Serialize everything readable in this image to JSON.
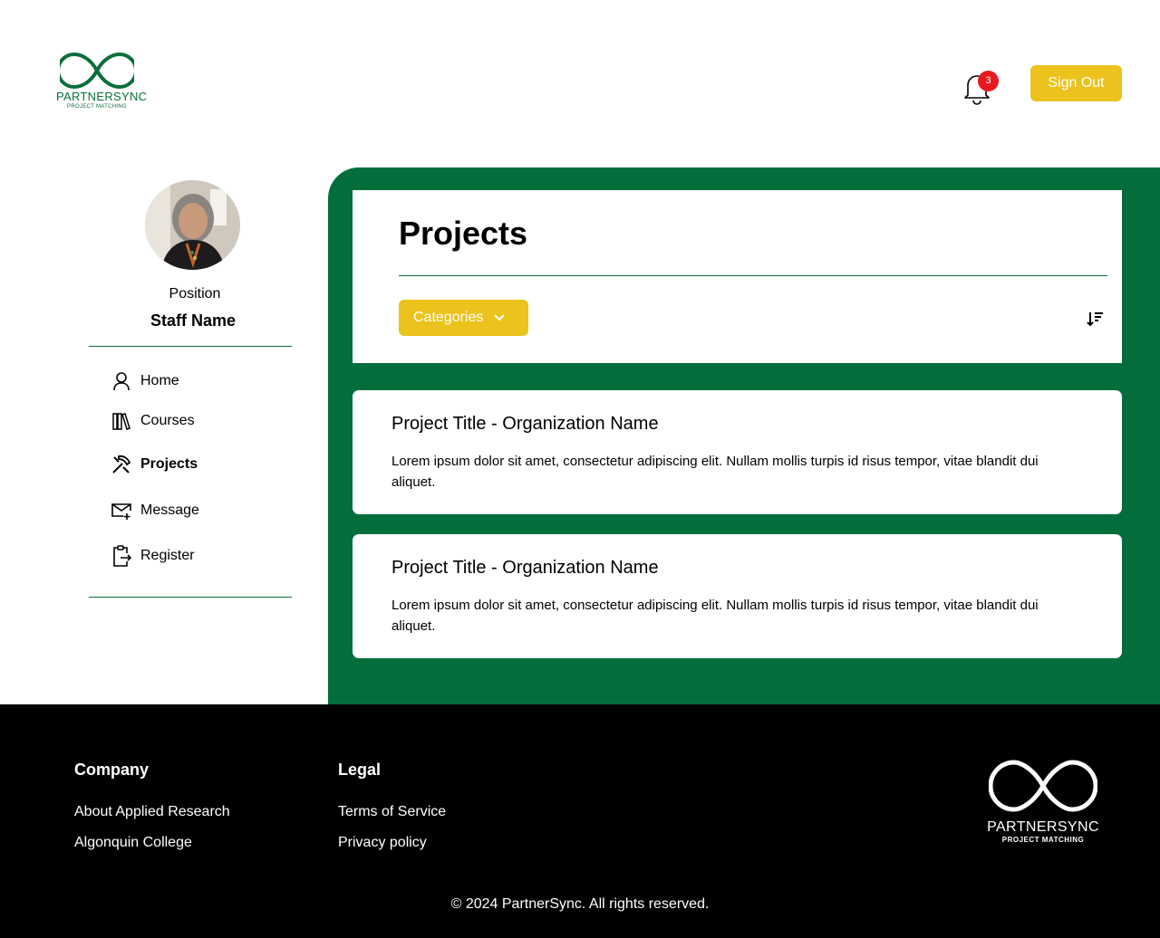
{
  "header": {
    "logo_brand": "PARTNERSYNC",
    "logo_sub": "PROJECT MATCHING",
    "notification_count": "3",
    "sign_out_label": "Sign Out"
  },
  "sidebar": {
    "position": "Position",
    "staff_name": "Staff Name",
    "items": [
      {
        "label": "Home",
        "icon": "user-icon"
      },
      {
        "label": "Courses",
        "icon": "books-icon"
      },
      {
        "label": "Projects",
        "icon": "tools-icon",
        "active": true
      },
      {
        "label": "Message",
        "icon": "mail-add-icon"
      },
      {
        "label": "Register",
        "icon": "clipboard-export-icon"
      }
    ]
  },
  "main": {
    "title": "Projects",
    "categories_label": "Categories",
    "projects": [
      {
        "title": "Project Title - Organization Name",
        "description": "Lorem ipsum dolor sit amet, consectetur adipiscing elit. Nullam mollis turpis id risus tempor, vitae blandit dui aliquet."
      },
      {
        "title": "Project Title - Organization Name",
        "description": "Lorem ipsum dolor sit amet, consectetur adipiscing elit. Nullam mollis turpis id risus tempor, vitae blandit dui aliquet."
      }
    ]
  },
  "footer": {
    "company_heading": "Company",
    "company_links": [
      "About Applied Research",
      "Algonquin College"
    ],
    "legal_heading": "Legal",
    "legal_links": [
      "Terms of Service",
      "Privacy policy"
    ],
    "logo_brand": "PARTNERSYNC",
    "logo_sub": "PROJECT MATCHING",
    "copyright": "© 2024 PartnerSync. All rights reserved."
  },
  "colors": {
    "brand_green": "#036e3c",
    "accent_yellow": "#ecc21c",
    "badge_red": "#e8191e"
  }
}
